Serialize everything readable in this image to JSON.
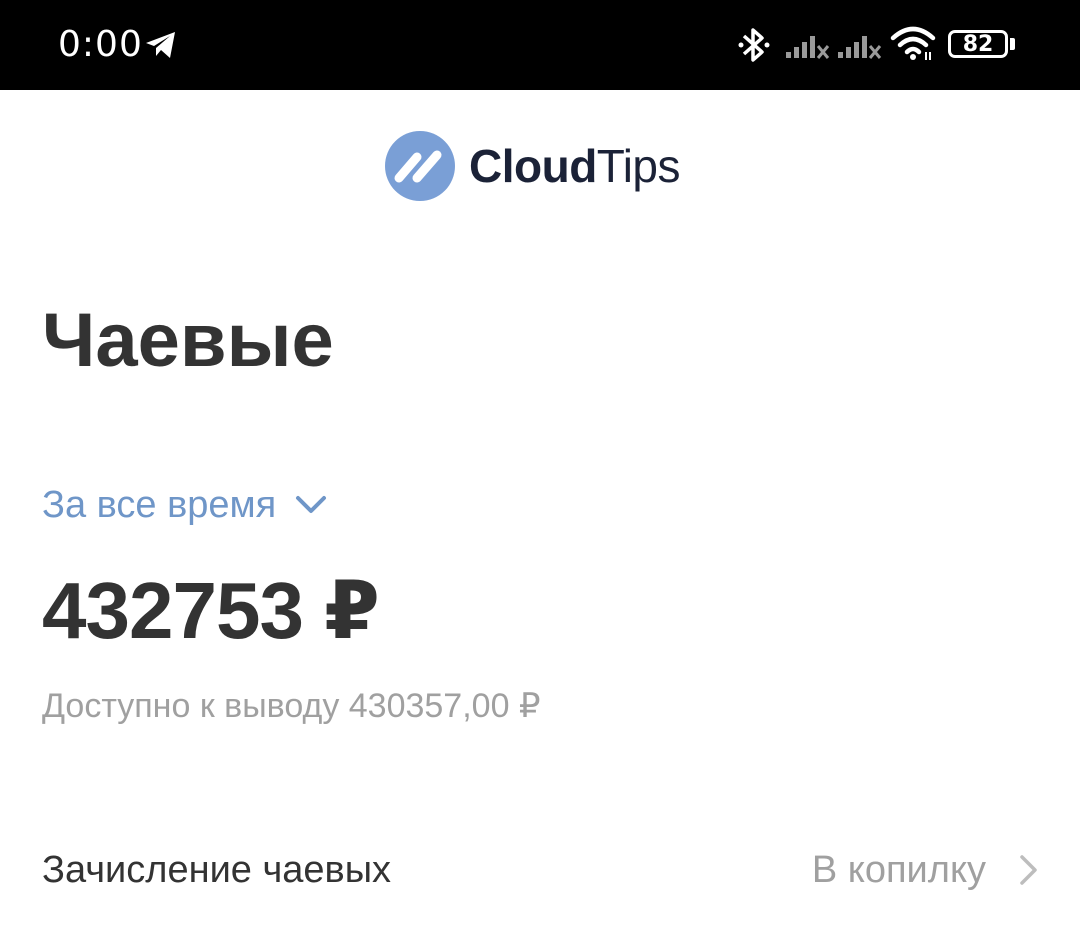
{
  "status_bar": {
    "time": "0:00",
    "battery": "82",
    "icons": [
      "telegram-icon",
      "bluetooth-icon",
      "signal-icon",
      "signal-icon",
      "wifi-icon",
      "battery-icon"
    ]
  },
  "logo": {
    "bold": "Cloud",
    "light": "Tips",
    "brand_color": "#7a9fd6",
    "text_color": "#1b2237"
  },
  "page": {
    "title": "Чаевые"
  },
  "period": {
    "selected": "За все время",
    "color": "#6f96c8"
  },
  "summary": {
    "total": "432753 ₽",
    "available": "Доступно к выводу 430357,00 ₽"
  },
  "settings_row": {
    "label": "Зачисление чаевых",
    "value": "В копилку"
  }
}
